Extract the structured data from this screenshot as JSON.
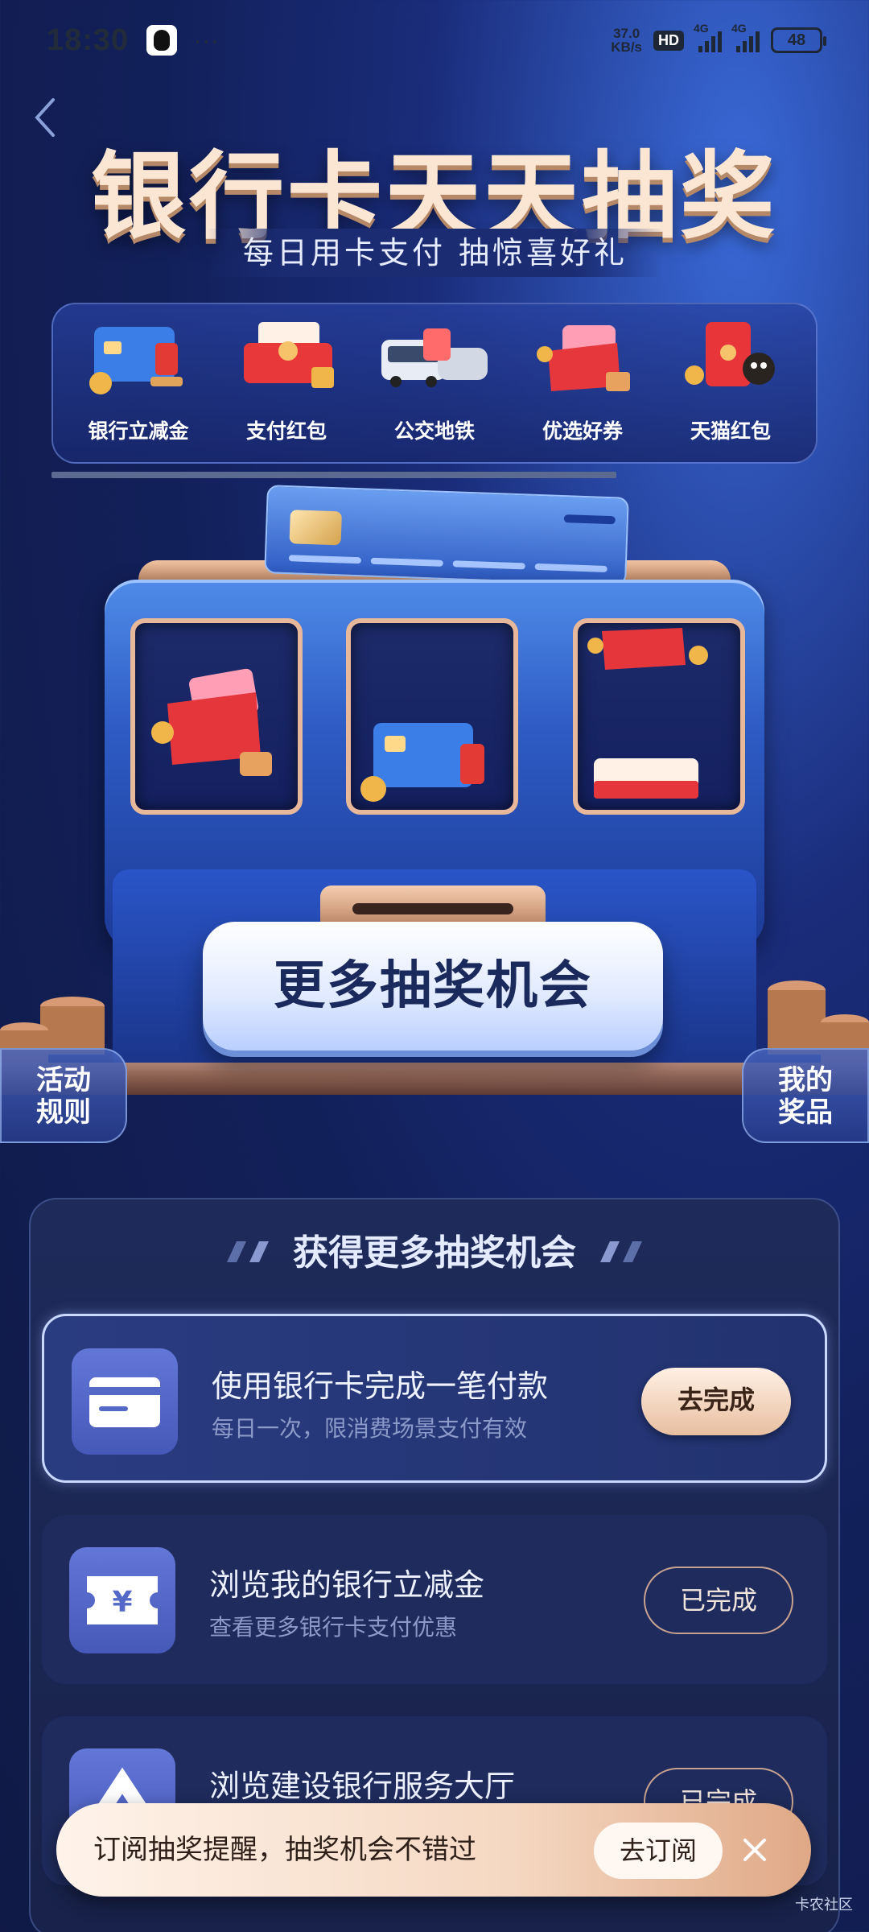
{
  "status_bar": {
    "time": "18:30",
    "speed_value": "37.0",
    "speed_unit": "KB/s",
    "hd": "HD",
    "net1": "4G",
    "net2": "4G",
    "battery": "48"
  },
  "header": {
    "title": "银行卡天天抽奖",
    "subtitle": "每日用卡支付 抽惊喜好礼"
  },
  "categories": [
    {
      "label": "银行立减金",
      "icon": "bank-card-coupon-icon"
    },
    {
      "label": "支付红包",
      "icon": "payment-red-packet-icon"
    },
    {
      "label": "公交地铁",
      "icon": "bus-subway-icon"
    },
    {
      "label": "优选好券",
      "icon": "coupon-icon"
    },
    {
      "label": "天猫红包",
      "icon": "tmall-red-packet-icon"
    }
  ],
  "machine": {
    "window_labels": [
      "优惠券",
      "",
      "支付红包"
    ],
    "more_button": "更多抽奖机会"
  },
  "side": {
    "rules": "活动\n规则",
    "prizes": "我的\n奖品"
  },
  "tasks_panel": {
    "title": "获得更多抽奖机会",
    "tasks": [
      {
        "name": "使用银行卡完成一笔付款",
        "desc": "每日一次，限消费场景支付有效",
        "button": "去完成",
        "icon": "card-icon"
      },
      {
        "name": "浏览我的银行立减金",
        "desc": "查看更多银行卡支付优惠",
        "button": "已完成",
        "icon": "yuan-ticket-icon"
      },
      {
        "name": "浏览建设银行服务大厅",
        "desc": "",
        "button": "已完成",
        "icon": "ccb-logo-icon"
      }
    ]
  },
  "subscribe": {
    "text": "订阅抽奖提醒，抽奖机会不错过",
    "button": "去订阅"
  },
  "watermark": "卡农社区"
}
